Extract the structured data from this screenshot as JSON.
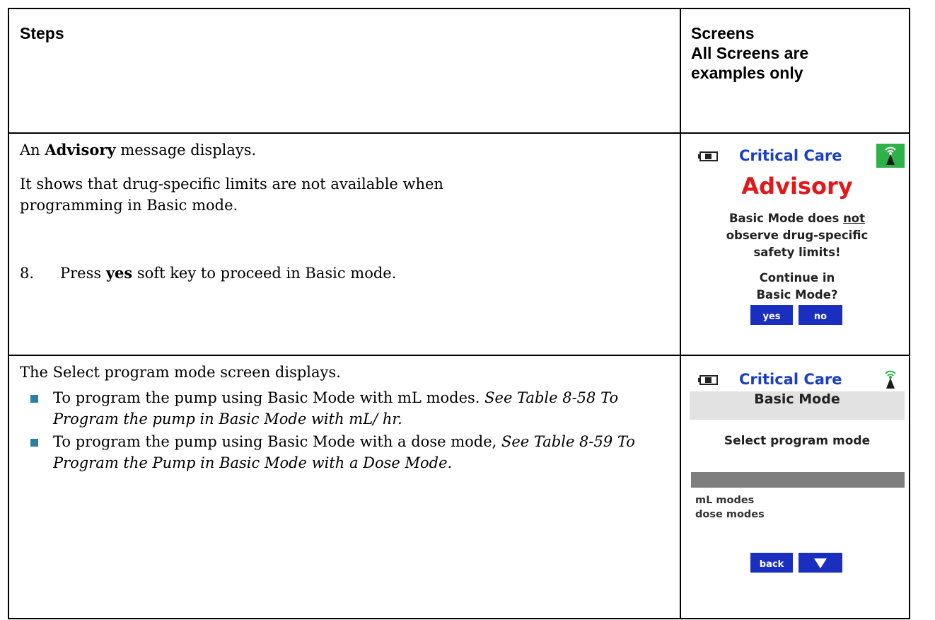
{
  "table": {
    "header": {
      "steps": "Steps",
      "screens_lines": [
        "Screens",
        "All Screens are",
        "examples only"
      ]
    },
    "row1": {
      "intro_prefix": "An ",
      "intro_bold": "Advisory",
      "intro_suffix": " message displays.",
      "para2": "It shows that drug-specific limits are not available when programming in Basic mode.",
      "step_number": "8.",
      "step_prefix": "Press ",
      "step_bold": "yes",
      "step_suffix": " soft key to proceed in Basic mode."
    },
    "row2": {
      "intro": "The Select program mode screen displays.",
      "bullets": [
        {
          "text": "To program the pump using Basic Mode with mL modes. ",
          "ref": "See Table 8-58 To Program the pump in Basic Mode with mL/ hr."
        },
        {
          "text": "To program the pump using Basic Mode with a dose mode, ",
          "ref": "See Table 8-59 To Program the Pump in Basic Mode with a Dose Mode."
        }
      ]
    }
  },
  "screen_advisory": {
    "title": "Critical Care",
    "heading": "Advisory",
    "line1_prefix": "Basic Mode does ",
    "line1_underlined": "not",
    "line2": "observe drug-specific",
    "line3": "safety limits!",
    "question_line1": "Continue in",
    "question_line2": "Basic Mode?",
    "softkey_yes": "yes",
    "softkey_no": "no",
    "icons": [
      "battery-icon",
      "wireless-icon"
    ],
    "colors": {
      "title": "#1a3fc4",
      "heading": "#e31818",
      "badge": "#2fb14a",
      "softkey": "#1a2fc0"
    }
  },
  "screen_select": {
    "title": "Critical Care",
    "band_label": "Basic Mode",
    "prompt": "Select program mode",
    "options": [
      "mL modes",
      "dose modes"
    ],
    "softkey_back": "back",
    "softkey_down_icon": "down-arrow-icon",
    "icons": [
      "battery-icon",
      "wireless-icon"
    ]
  }
}
